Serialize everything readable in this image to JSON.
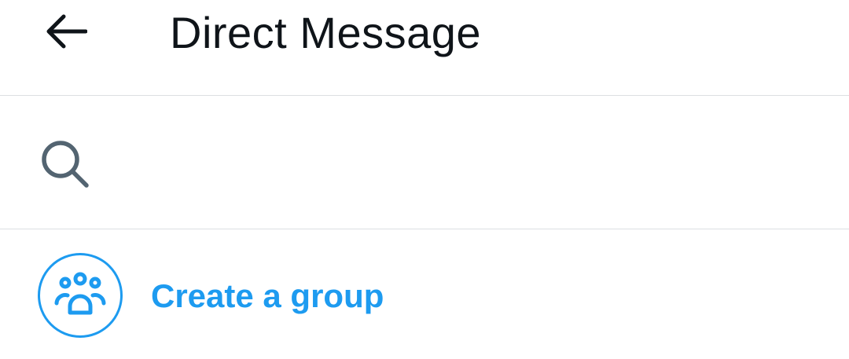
{
  "header": {
    "title": "Direct Message",
    "back_icon": "arrow-left-icon"
  },
  "search": {
    "icon": "search-icon",
    "placeholder": "",
    "value": ""
  },
  "create_group": {
    "label": "Create a group",
    "icon": "people-group-icon",
    "accent_color": "#1d9bf0"
  },
  "colors": {
    "text_primary": "#0f1419",
    "icon_gray": "#536471",
    "divider": "#dcdfe2",
    "accent": "#1d9bf0"
  }
}
